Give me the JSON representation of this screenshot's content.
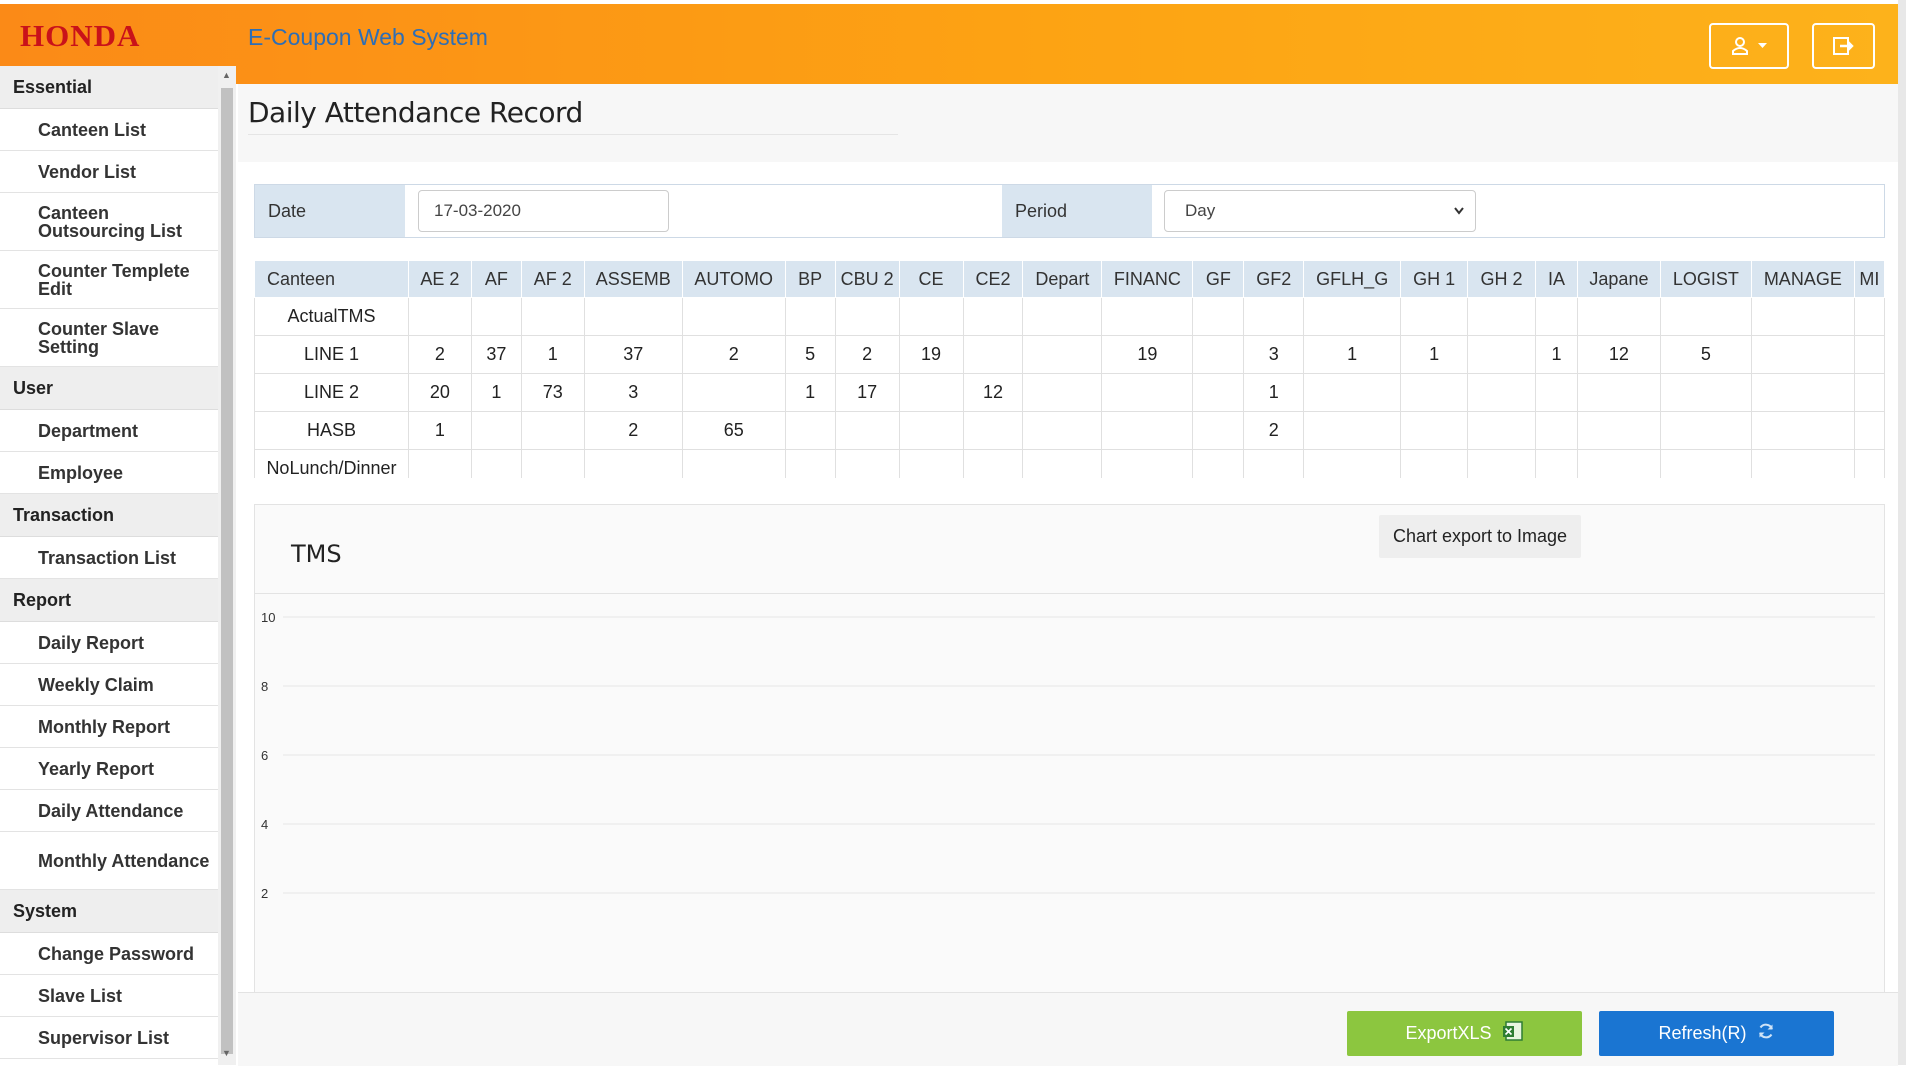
{
  "header": {
    "logo": "HONDA",
    "app_title": "E-Coupon Web System"
  },
  "sidebar": {
    "sections": [
      {
        "title": "Essential",
        "items": [
          {
            "label": "Canteen List"
          },
          {
            "label": "Vendor List"
          },
          {
            "label": "Canteen Outsourcing List",
            "tall": true
          },
          {
            "label": "Counter Templete Edit",
            "tall": true
          },
          {
            "label": "Counter Slave Setting",
            "tall": true
          }
        ]
      },
      {
        "title": "User",
        "items": [
          {
            "label": "Department"
          },
          {
            "label": "Employee"
          }
        ]
      },
      {
        "title": "Transaction",
        "items": [
          {
            "label": "Transaction List"
          }
        ]
      },
      {
        "title": "Report",
        "items": [
          {
            "label": "Daily Report"
          },
          {
            "label": "Weekly Claim"
          },
          {
            "label": "Monthly Report"
          },
          {
            "label": "Yearly Report"
          },
          {
            "label": "Daily Attendance"
          },
          {
            "label": "Monthly Attendance",
            "tall": true
          }
        ]
      },
      {
        "title": "System",
        "items": [
          {
            "label": "Change Password"
          },
          {
            "label": "Slave List"
          },
          {
            "label": "Supervisor List"
          }
        ]
      }
    ]
  },
  "page": {
    "title": "Daily Attendance Record"
  },
  "filter": {
    "date_label": "Date",
    "date_value": "17-03-2020",
    "period_label": "Period",
    "period_value": "Day"
  },
  "table": {
    "headers": [
      "Canteen",
      "AE 2",
      "AF",
      "AF 2",
      "ASSEMB",
      "AUTOMO",
      "BP",
      "CBU 2",
      "CE",
      "CE2",
      "Depart",
      "FINANC",
      "GF",
      "GF2",
      "GFLH_G",
      "GH 1",
      "GH 2",
      "IA",
      "Japane",
      "LOGIST",
      "MANAGE",
      "MI"
    ],
    "rows": [
      [
        "ActualTMS",
        "",
        "",
        "",
        "",
        "",
        "",
        "",
        "",
        "",
        "",
        "",
        "",
        "",
        "",
        "",
        "",
        "",
        "",
        "",
        "",
        ""
      ],
      [
        "LINE 1",
        "2",
        "37",
        "1",
        "37",
        "2",
        "5",
        "2",
        "19",
        "",
        "",
        "19",
        "",
        "3",
        "1",
        "1",
        "",
        "1",
        "12",
        "5",
        "",
        ""
      ],
      [
        "LINE 2",
        "20",
        "1",
        "73",
        "3",
        "",
        "1",
        "17",
        "",
        "12",
        "",
        "",
        "",
        "1",
        "",
        "",
        "",
        "",
        "",
        "",
        "",
        ""
      ],
      [
        "HASB",
        "1",
        "",
        "",
        "2",
        "65",
        "",
        "",
        "",
        "",
        "",
        "",
        "",
        "2",
        "",
        "",
        "",
        "",
        "",
        "",
        "",
        ""
      ],
      [
        "NoLunch/Dinner",
        "",
        "",
        "",
        "",
        "",
        "",
        "",
        "",
        "",
        "",
        "",
        "",
        "",
        "",
        "",
        "",
        "",
        "",
        "",
        "",
        ""
      ]
    ]
  },
  "chart": {
    "title": "TMS",
    "export_label": "Chart export to Image"
  },
  "chart_data": {
    "type": "bar",
    "title": "TMS",
    "categories": [],
    "values": [],
    "yticks": [
      "10",
      "8",
      "6",
      "4",
      "2"
    ],
    "ylim": [
      0,
      10
    ],
    "grid": true
  },
  "footer": {
    "export_xls_label": "ExportXLS",
    "refresh_label": "Refresh(R)"
  },
  "colors": {
    "header_start": "#fb8a17",
    "header_end": "#fdb21b",
    "logo": "#c9121a",
    "app_title": "#2e6eb5",
    "table_header": "#d9e5f0",
    "export_button": "#8cc63f",
    "refresh_button": "#1a75d2"
  }
}
